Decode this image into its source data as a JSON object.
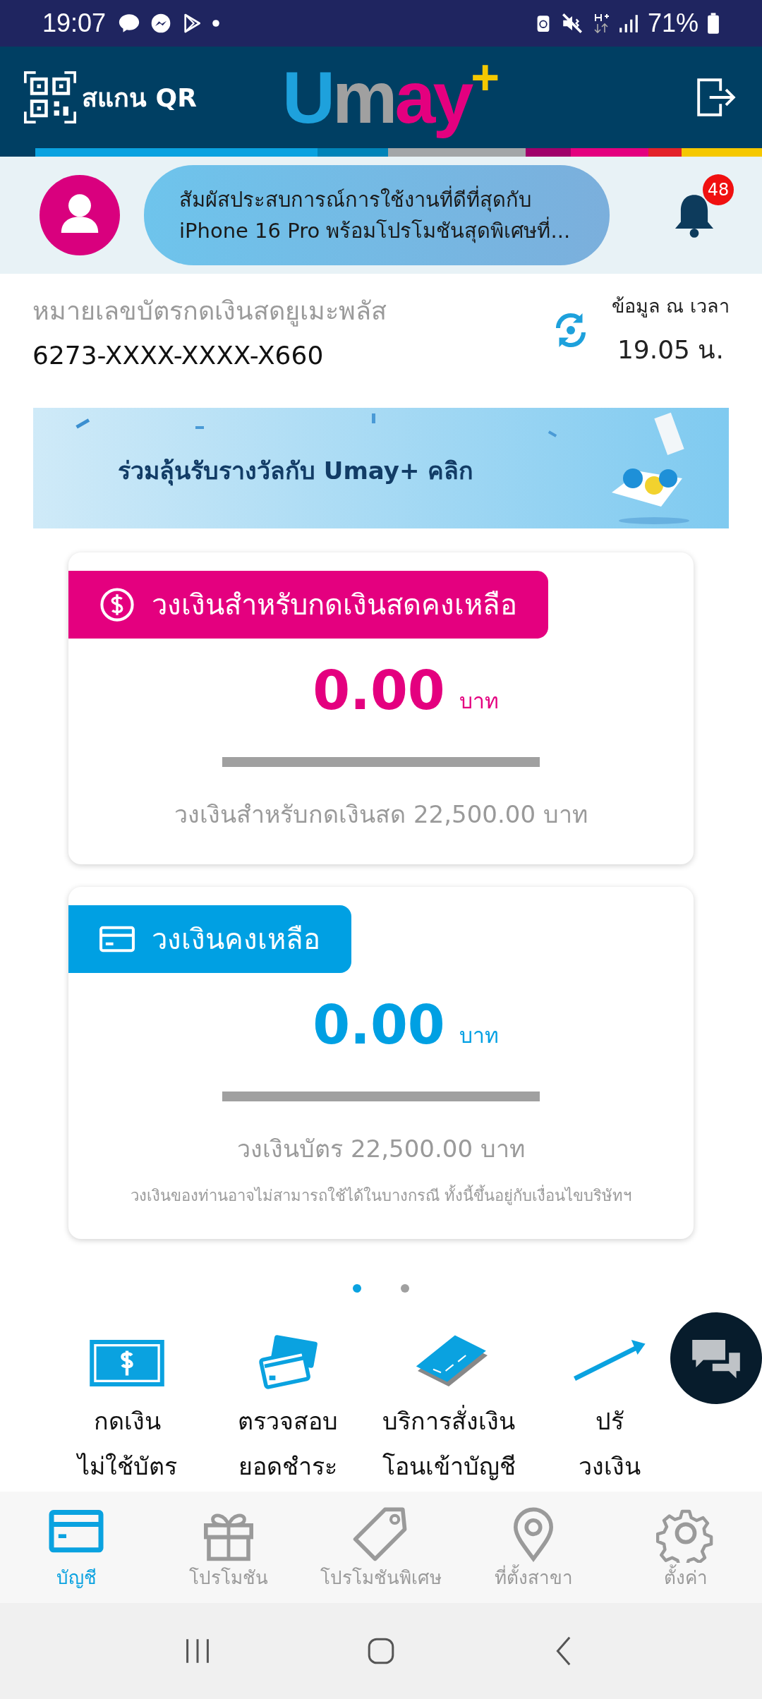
{
  "status_bar": {
    "time": "19:07",
    "battery": "71%"
  },
  "header": {
    "scan_label": "สแกน QR",
    "logo": "Umay$^{+}$"
  },
  "profile": {
    "message_lines": [
      "สัมผัสประสบการณ์การใช้งานที่ดีที่สุดกับ",
      "iPhone 16 Pro พร้อมโปรโมชันสุดพิเศษที่..."
    ],
    "notification_count": "48"
  },
  "account": {
    "label": "หมายเลขบัตรกดเงินสดยูเมะพลัส",
    "number": "6273-XXXX-XXXX-X660",
    "updated_label": "ข้อมูล ณ เวลา",
    "updated_time": "19.05 น."
  },
  "banner": {
    "text": "ร่วมลุ้นรับรางวัลกับ Umay+ คลิก"
  },
  "cards": [
    {
      "kind": "cash",
      "color": "#e4007f",
      "title": "วงเงินสำหรับกดเงินสดคงเหลือ",
      "amount": "0.00",
      "unit": "บาท",
      "limit_text": "วงเงินสำหรับกดเงินสด 22,500.00 บาท"
    },
    {
      "kind": "card",
      "color": "#00a0e3",
      "title": "วงเงินคงเหลือ",
      "amount": "0.00",
      "unit": "บาท",
      "limit_text": "วงเงินบัตร 22,500.00 บาท",
      "note": "วงเงินของท่านอาจไม่สามารถใช้ได้ในบางกรณี ทั้งนี้ขึ้นอยู่กับเงื่อนไขบริษัทฯ"
    }
  ],
  "carousel_dots": [
    {
      "selected": true
    },
    {
      "selected": false
    }
  ],
  "actions": [
    {
      "kind": "cash",
      "lines": [
        "กดเงิน",
        "ไม่ใช้บัตร"
      ]
    },
    {
      "kind": "cards",
      "lines": [
        "ตรวจสอบ",
        "ยอดชำระ"
      ]
    },
    {
      "kind": "book",
      "lines": [
        "บริการสั่งเงิน",
        "โอนเข้าบัญชี"
      ]
    },
    {
      "kind": "raise",
      "lines": [
        "ปรั",
        "วงเงิน"
      ]
    }
  ],
  "nav": [
    {
      "kind": "account",
      "label": "บัญชี",
      "selected": true
    },
    {
      "kind": "gift",
      "label": "โปรโมชัน",
      "selected": false
    },
    {
      "kind": "tag",
      "label": "โปรโมชันพิเศษ",
      "selected": false
    },
    {
      "kind": "pin",
      "label": "ที่ตั้งสาขา",
      "selected": false
    },
    {
      "kind": "gear",
      "label": "ตั้งค่า",
      "selected": false
    }
  ]
}
